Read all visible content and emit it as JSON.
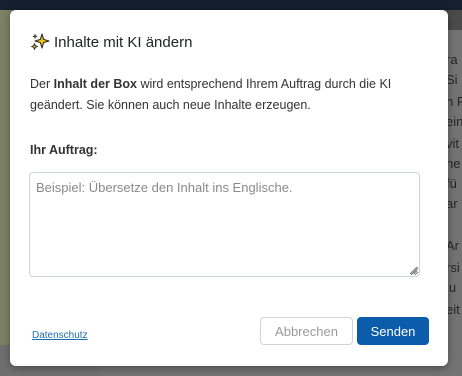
{
  "background": {
    "fragments": [
      "ra",
      "Si",
      "n F",
      "ein",
      "vit",
      "ne",
      "fü",
      "ar",
      "Ar",
      "rsi",
      "lu",
      "eit"
    ]
  },
  "dialog": {
    "title": "Inhalte mit KI ändern",
    "title_icon": "sparkle-icon",
    "description_prefix": "Der ",
    "description_bold": "Inhalt der Box",
    "description_suffix": " wird entsprechend Ihrem Auftrag durch die KI geändert. Sie können auch neue Inhalte erzeugen.",
    "field_label": "Ihr Auftrag:",
    "textarea_value": "",
    "textarea_placeholder": "Beispiel: Übersetze den Inhalt ins Englische.",
    "privacy_link": "Datenschutz",
    "cancel_label": "Abbrechen",
    "send_label": "Senden"
  },
  "colors": {
    "primary": "#0b5cab",
    "link": "#1a6fb5",
    "sparkle_gold": "#f2c21b"
  }
}
